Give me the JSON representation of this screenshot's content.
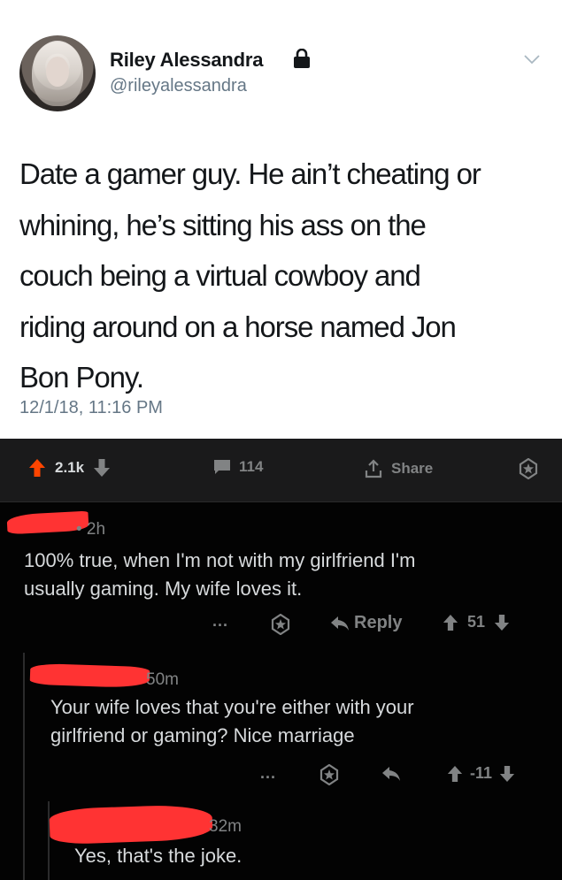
{
  "tweet": {
    "author_name": "Riley Alessandra",
    "handle": "@rileyalessandra",
    "text_lines": [
      "Date a gamer guy. He ain’t cheating or",
      "whining, he’s sitting his ass on the",
      "couch being a virtual cowboy and",
      "riding around on a horse named Jon",
      "Bon Pony."
    ],
    "timestamp": "12/1/18, 11:16 PM"
  },
  "post_bar": {
    "score": "2.1k",
    "comments": "114",
    "share_label": "Share"
  },
  "comments": [
    {
      "age": "• 2h",
      "text_lines": [
        "100% true, when I'm not with my girlfriend I'm",
        "usually gaming. My wife loves it."
      ],
      "more": "...",
      "reply_label": "Reply",
      "score": "51"
    },
    {
      "age": "50m",
      "text_lines": [
        "Your wife loves that you're either with your",
        "girlfriend or gaming? Nice marriage"
      ],
      "more": "...",
      "score": "-11"
    },
    {
      "age": "32m",
      "text_lines": [
        "Yes, that's the joke."
      ]
    }
  ],
  "colors": {
    "upvote": "#ff4500",
    "redaction": "#ff3333",
    "reddit_bar": "#1a1a1b",
    "reddit_bg": "#030303"
  }
}
